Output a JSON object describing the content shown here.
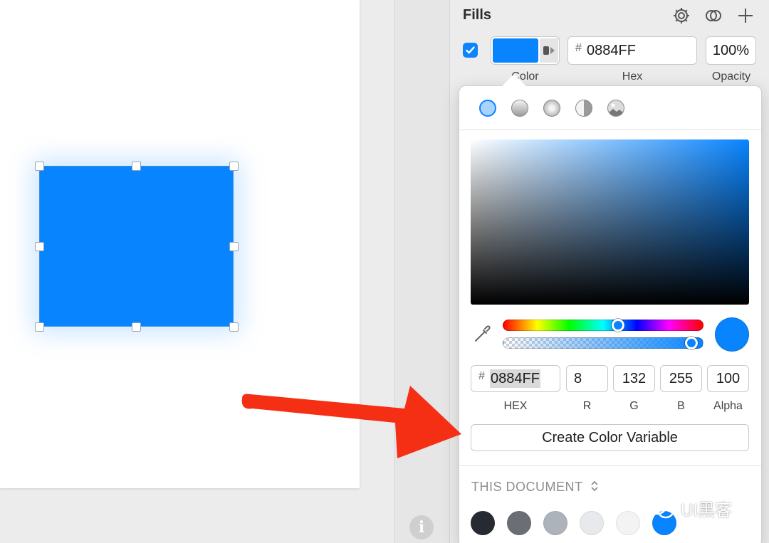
{
  "inspector": {
    "title": "Fills",
    "fill": {
      "hex_value": "0884FF",
      "hex_prefix": "#",
      "opacity": "100%",
      "labels": {
        "color": "Color",
        "hex": "Hex",
        "opacity": "Opacity"
      },
      "swatch_color": "#0884FF"
    },
    "icons": [
      "gear-icon",
      "blend-mode-icon",
      "plus-icon"
    ]
  },
  "color_picker": {
    "fill_types": [
      "solid-fill-icon",
      "linear-gradient-icon",
      "radial-gradient-icon",
      "angular-gradient-icon",
      "image-fill-icon"
    ],
    "hue_fraction": 0.58,
    "alpha_fraction": 1.0,
    "fields": {
      "hex_prefix": "#",
      "hex": "0884FF",
      "r": "8",
      "g": "132",
      "b": "255",
      "alpha": "100"
    },
    "labels": {
      "hex": "HEX",
      "r": "R",
      "g": "G",
      "b": "B",
      "alpha": "Alpha"
    },
    "create_button": "Create Color Variable",
    "document_section": {
      "title": "THIS DOCUMENT",
      "swatches": [
        "#262a33",
        "#6b6f75",
        "#adb3ba",
        "#e7e9ec",
        "#f3f3f3",
        "#0884FF"
      ]
    }
  },
  "canvas": {
    "shape_color": "#0884FF"
  },
  "watermark": {
    "text": "UI黑客"
  }
}
